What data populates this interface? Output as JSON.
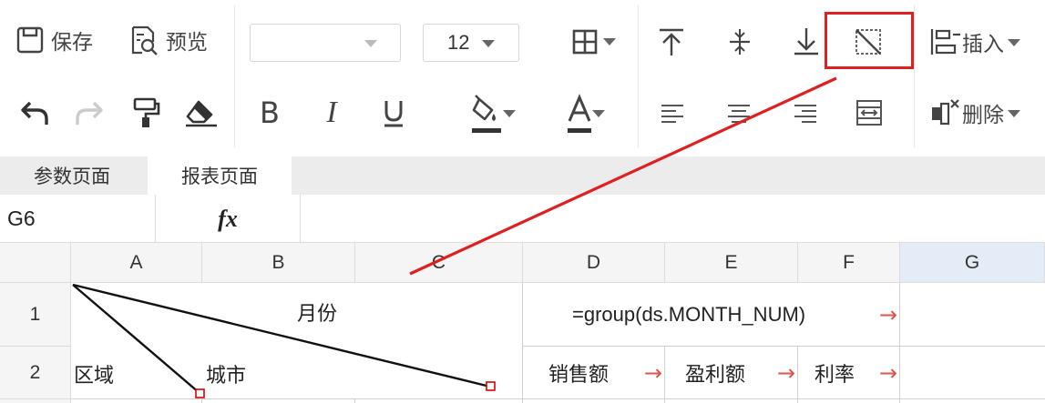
{
  "toolbar": {
    "save_label": "保存",
    "preview_label": "预览",
    "font_name_value": "",
    "font_size_value": "12",
    "insert_label": "插入",
    "delete_label": "删除"
  },
  "tabs": [
    {
      "label": "参数页面",
      "active": false
    },
    {
      "label": "报表页面",
      "active": true
    }
  ],
  "formula_bar": {
    "cell_ref": "G6",
    "fx_label": "fx",
    "formula": ""
  },
  "grid": {
    "columns": [
      "A",
      "B",
      "C",
      "D",
      "E",
      "F",
      "G"
    ],
    "selected_column": "G",
    "rows": [
      "1",
      "2"
    ],
    "diagonal_header": {
      "top_label": "月份",
      "left_label": "区域",
      "middle_label": "城市"
    },
    "cells": {
      "D1": "=group(ds.MONTH_NUM)",
      "D2": "销售额",
      "E2": "盈利额",
      "F2": "利率"
    },
    "expand_arrow": "→"
  },
  "colors": {
    "highlight": "#e02020",
    "arrow": "#d9534f",
    "selected_header": "#e4ecf7"
  }
}
